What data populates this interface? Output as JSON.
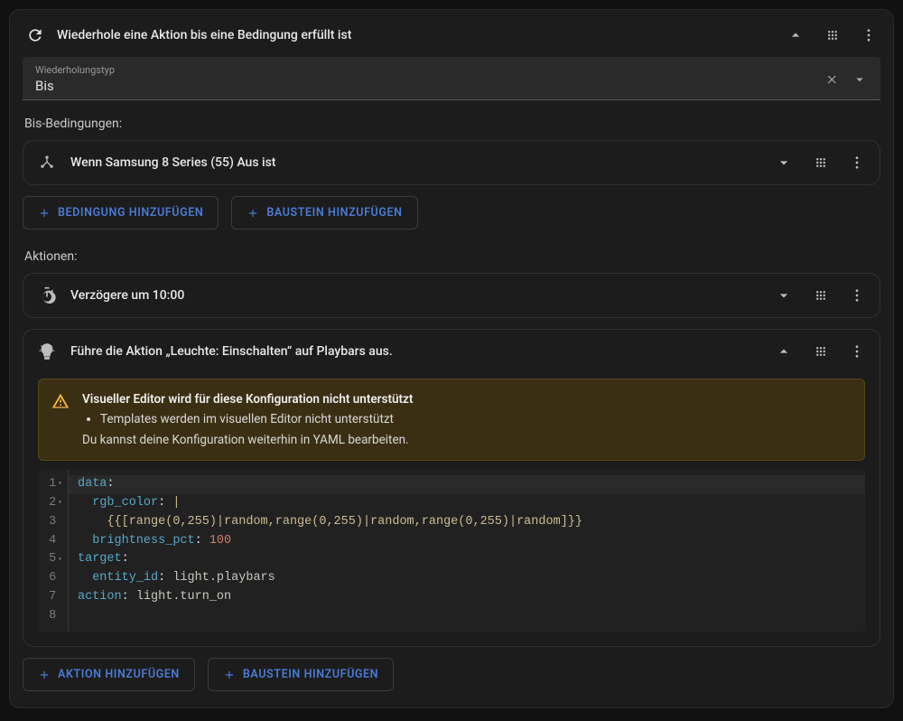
{
  "header": {
    "title": "Wiederhole eine Aktion bis eine Bedingung erfüllt ist"
  },
  "repeat_type": {
    "label": "Wiederholungstyp",
    "value": "Bis"
  },
  "conditions": {
    "section_label": "Bis-Bedingungen:",
    "items": [
      {
        "title": "Wenn Samsung 8 Series (55) Aus ist"
      }
    ],
    "add_condition": "Bedingung hinzufügen",
    "add_block": "Baustein hinzufügen"
  },
  "actions": {
    "section_label": "Aktionen:",
    "items": [
      {
        "title": "Verzögere um 10:00",
        "expanded": false
      },
      {
        "title": "Führe die Aktion „Leuchte: Einschalten“ auf Playbars aus.",
        "expanded": true
      }
    ],
    "add_action": "Aktion hinzufügen",
    "add_block": "Baustein hinzufügen"
  },
  "warning": {
    "title": "Visueller Editor wird für diese Konfiguration nicht unterstützt",
    "bullet1": "Templates werden im visuellen Editor nicht unterstützt",
    "footer": "Du kannst deine Konfiguration weiterhin in YAML bearbeiten."
  },
  "yaml": {
    "lines": [
      "data:",
      " rgb_color: |",
      "   {{[range(0,255)|random,range(0,255)|random,range(0,255)|random]}}",
      " brightness_pct: 100",
      "target:",
      " entity_id: light.playbars",
      "action: light.turn_on",
      ""
    ],
    "line_count": 8
  }
}
